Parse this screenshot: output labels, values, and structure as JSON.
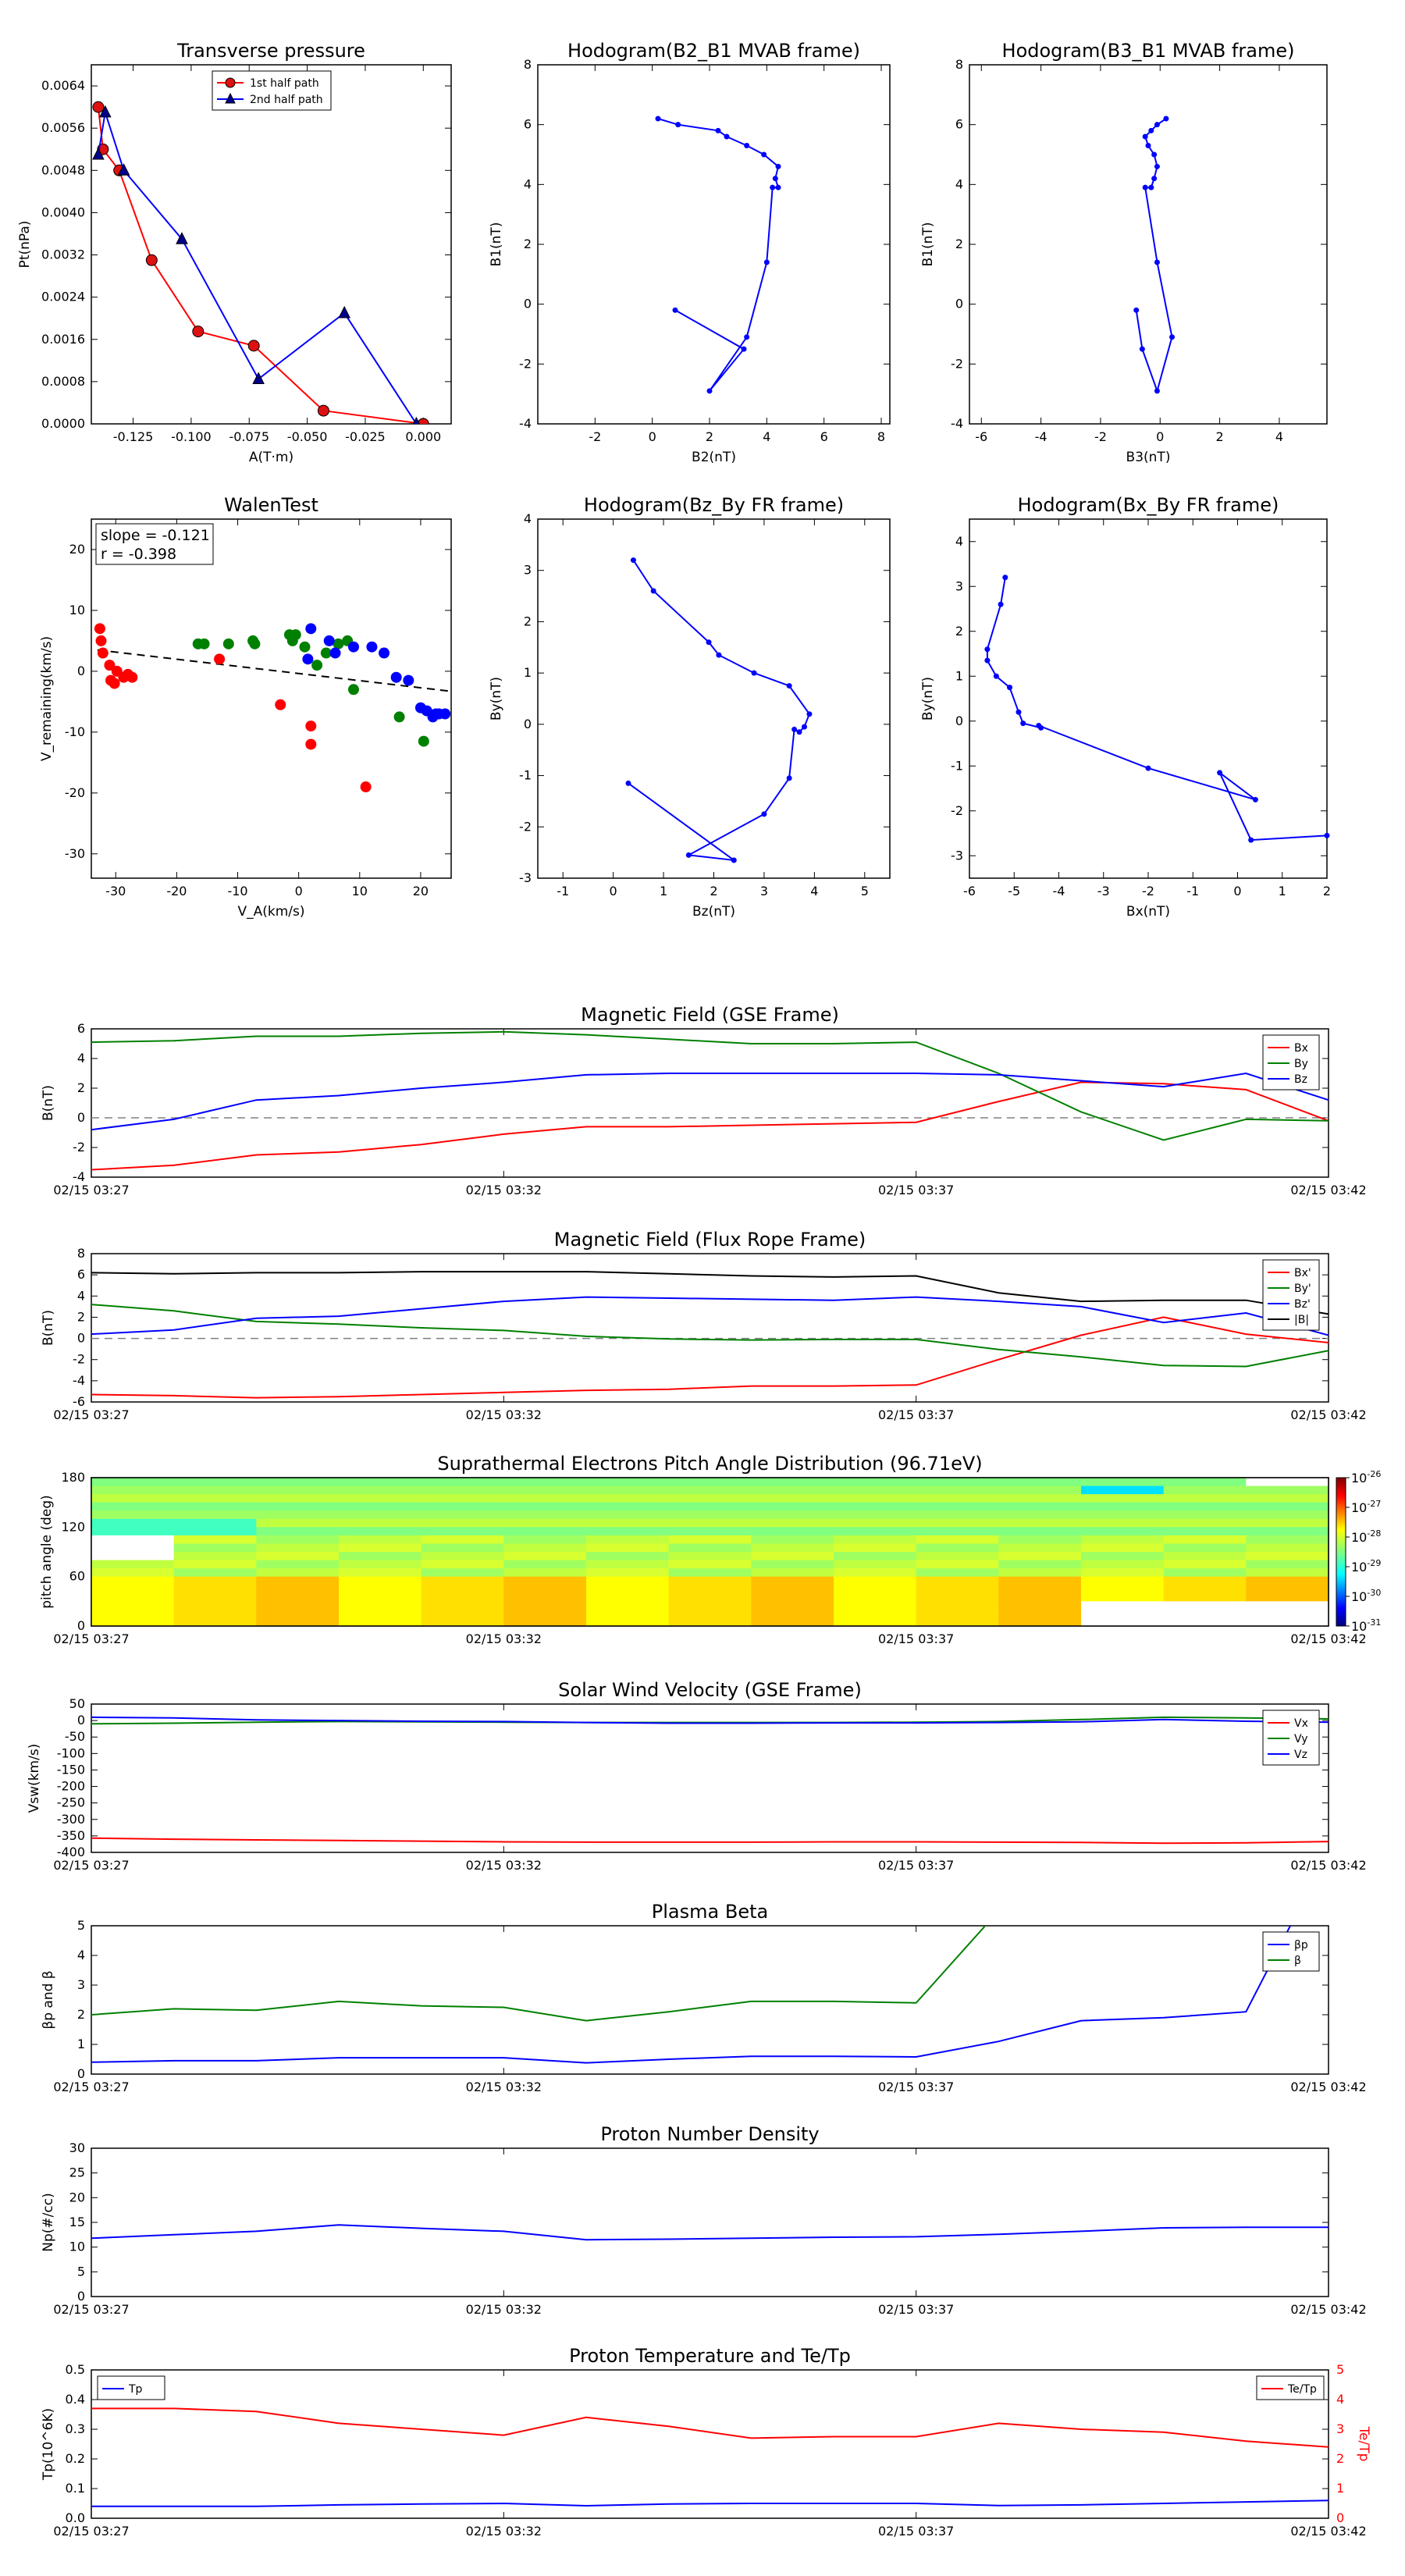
{
  "colors": {
    "red": "#ff0000",
    "green": "#008000",
    "blue": "#0000ff",
    "black": "#000000",
    "dash": "#808080"
  },
  "time_ticks": [
    "02/15 03:27",
    "02/15 03:32",
    "02/15 03:37",
    "02/15 03:42"
  ],
  "chart_data": [
    {
      "id": "pt",
      "type": "line",
      "title": "Transverse pressure",
      "xlabel": "A(T·m)",
      "ylabel": "Pt(nPa)",
      "xlim": [
        -0.143,
        0.012
      ],
      "ylim": [
        0,
        0.0068
      ],
      "xticks": [
        "-0.125",
        "-0.100",
        "-0.075",
        "-0.050",
        "-0.025",
        "0.000"
      ],
      "yticks": [
        "0.0000",
        "0.0008",
        "0.0016",
        "0.0024",
        "0.0032",
        "0.0040",
        "0.0048",
        "0.0056",
        "0.0064"
      ],
      "legend_position": "top-center",
      "series": [
        {
          "name": "1st half path",
          "marker": "circle",
          "x": [
            -0.14,
            -0.138,
            -0.131,
            -0.117,
            -0.097,
            -0.073,
            -0.043,
            0.0
          ],
          "y": [
            0.006,
            0.0052,
            0.0048,
            0.0031,
            0.00175,
            0.00148,
            0.00025,
            0.0
          ]
        },
        {
          "name": "2nd half path",
          "marker": "triangle",
          "x": [
            -0.14,
            -0.137,
            -0.129,
            -0.104,
            -0.071,
            -0.034,
            -0.003
          ],
          "y": [
            0.0051,
            0.0059,
            0.0048,
            0.0035,
            0.00085,
            0.0021,
            0.0
          ]
        }
      ]
    },
    {
      "id": "hb2",
      "type": "line",
      "title": "Hodogram(B2_B1 MVAB frame)",
      "xlabel": "B2(nT)",
      "ylabel": "B1(nT)",
      "xlim": [
        -4,
        8.3
      ],
      "ylim": [
        -4,
        8
      ],
      "xticks": [
        "-2",
        "0",
        "2",
        "4",
        "6",
        "8"
      ],
      "yticks": [
        "-4",
        "-2",
        "0",
        "2",
        "4",
        "6",
        "8"
      ],
      "x": [
        0.2,
        0.9,
        2.3,
        2.6,
        3.3,
        3.9,
        4.4,
        4.3,
        4.4,
        4.2,
        4.0,
        3.3,
        2.0,
        3.2,
        0.8
      ],
      "y": [
        6.2,
        6.0,
        5.8,
        5.6,
        5.3,
        5.0,
        4.6,
        4.2,
        3.9,
        3.9,
        1.4,
        -1.1,
        -2.9,
        -1.5,
        -0.2
      ]
    },
    {
      "id": "hb3",
      "type": "line",
      "title": "Hodogram(B3_B1 MVAB frame)",
      "xlabel": "B3(nT)",
      "ylabel": "B1(nT)",
      "xlim": [
        -6.4,
        5.6
      ],
      "ylim": [
        -4,
        8
      ],
      "xticks": [
        "-6",
        "-4",
        "-2",
        "0",
        "2",
        "4"
      ],
      "yticks": [
        "-4",
        "-2",
        "0",
        "2",
        "4",
        "6",
        "8"
      ],
      "x": [
        0.2,
        -0.1,
        -0.3,
        -0.5,
        -0.4,
        -0.2,
        -0.1,
        -0.2,
        -0.3,
        -0.5,
        -0.1,
        0.4,
        -0.1,
        -0.6,
        -0.8
      ],
      "y": [
        6.2,
        6.0,
        5.8,
        5.6,
        5.3,
        5.0,
        4.6,
        4.2,
        3.9,
        3.9,
        1.4,
        -1.1,
        -2.9,
        -1.5,
        -0.2
      ]
    },
    {
      "id": "walen",
      "type": "scatter",
      "title": "WalenTest",
      "xlabel": "V_A(km/s)",
      "ylabel": "V_remaining(km/s)",
      "xlim": [
        -34,
        25
      ],
      "ylim": [
        -34,
        25
      ],
      "xticks": [
        "-30",
        "-20",
        "-10",
        "0",
        "10",
        "20"
      ],
      "yticks": [
        "-30",
        "-20",
        "-10",
        "0",
        "10",
        "20"
      ],
      "slope_text": "slope = -0.121",
      "r_text": "r = -0.398",
      "fit": {
        "x": [
          -33,
          25
        ],
        "y": [
          3.5,
          -3.3
        ]
      },
      "groups": [
        {
          "color": "red",
          "x": [
            -32.6,
            -32.4,
            -32.1,
            -31,
            -30.8,
            -30.2,
            -29.8,
            -28.7,
            -28,
            -27.3,
            -13,
            -3,
            2,
            2,
            11
          ],
          "y": [
            7,
            5,
            3,
            1,
            -1.5,
            -2,
            0,
            -1,
            -0.5,
            -1,
            2,
            -5.5,
            -12,
            -9,
            -19
          ]
        },
        {
          "color": "green",
          "x": [
            -16.5,
            -15.5,
            -11.5,
            -7.5,
            -7.2,
            -1.5,
            -1,
            -0.5,
            1,
            3,
            4.5,
            6.5,
            8,
            9,
            16.5,
            20.5
          ],
          "y": [
            4.5,
            4.5,
            4.5,
            5,
            4.5,
            6,
            5,
            6,
            4,
            1,
            3,
            4.5,
            5,
            -3,
            -7.5,
            -11.5
          ]
        },
        {
          "color": "blue",
          "x": [
            1.5,
            2,
            5,
            6,
            9,
            12,
            14,
            16,
            18,
            20,
            21,
            22,
            22.5,
            23,
            24
          ],
          "y": [
            2,
            7,
            5,
            3,
            4,
            4,
            3,
            -1,
            -1.5,
            -6,
            -6.5,
            -7.5,
            -7,
            -7,
            -7
          ]
        }
      ]
    },
    {
      "id": "hbzby",
      "type": "line",
      "title": "Hodogram(Bz_By FR frame)",
      "xlabel": "Bz(nT)",
      "ylabel": "By(nT)",
      "xlim": [
        -1.5,
        5.5
      ],
      "ylim": [
        -3,
        4
      ],
      "xticks": [
        "-1",
        "0",
        "1",
        "2",
        "3",
        "4",
        "5"
      ],
      "yticks": [
        "-3",
        "-2",
        "-1",
        "0",
        "1",
        "2",
        "3",
        "4"
      ],
      "x": [
        0.4,
        0.8,
        1.9,
        2.1,
        2.8,
        3.5,
        3.9,
        3.8,
        3.7,
        3.6,
        3.5,
        3.0,
        1.5,
        2.4,
        0.3
      ],
      "y": [
        3.2,
        2.6,
        1.6,
        1.35,
        1.0,
        0.75,
        0.2,
        -0.05,
        -0.15,
        -0.1,
        -1.05,
        -1.75,
        -2.55,
        -2.65,
        -1.15
      ]
    },
    {
      "id": "hbxby",
      "type": "line",
      "title": "Hodogram(Bx_By FR frame)",
      "xlabel": "Bx(nT)",
      "ylabel": "By(nT)",
      "xlim": [
        -6,
        2
      ],
      "ylim": [
        -3.5,
        4.5
      ],
      "xticks": [
        "-6",
        "-5",
        "-4",
        "-3",
        "-2",
        "-1",
        "0",
        "1",
        "2"
      ],
      "yticks": [
        "-3",
        "-2",
        "-1",
        "0",
        "1",
        "2",
        "3",
        "4"
      ],
      "x": [
        -5.2,
        -5.3,
        -5.6,
        -5.6,
        -5.4,
        -5.1,
        -4.9,
        -4.8,
        -4.4,
        -4.45,
        -2.0,
        0.4,
        -0.4,
        0.3,
        2.0
      ],
      "y": [
        3.2,
        2.6,
        1.6,
        1.35,
        1.0,
        0.75,
        0.2,
        -0.05,
        -0.15,
        -0.1,
        -1.05,
        -1.75,
        -1.15,
        -2.65,
        -2.55
      ]
    },
    {
      "id": "bgse",
      "type": "line",
      "title": "Magnetic Field (GSE Frame)",
      "ylabel": "B(nT)",
      "ylim": [
        -4,
        6
      ],
      "yticks": [
        "-4",
        "-2",
        "0",
        "2",
        "4",
        "6"
      ],
      "zero_line": true,
      "x_times": [
        0,
        1,
        2,
        3,
        4,
        5,
        6,
        7,
        8,
        9,
        10,
        11,
        12,
        13,
        14,
        15
      ],
      "series": [
        {
          "name": "Bx",
          "color": "red",
          "values": [
            -3.5,
            -3.2,
            -2.5,
            -2.3,
            -1.8,
            -1.1,
            -0.6,
            -0.6,
            -0.5,
            -0.4,
            -0.3,
            1.1,
            2.4,
            2.3,
            1.9,
            -0.2
          ]
        },
        {
          "name": "By",
          "color": "green",
          "values": [
            5.1,
            5.2,
            5.5,
            5.5,
            5.7,
            5.8,
            5.6,
            5.3,
            5.0,
            5.0,
            5.1,
            3.0,
            0.4,
            -1.5,
            -0.1,
            -0.2
          ]
        },
        {
          "name": "Bz",
          "color": "blue",
          "values": [
            -0.8,
            -0.1,
            1.2,
            1.5,
            2.0,
            2.4,
            2.9,
            3.0,
            3.0,
            3.0,
            3.0,
            2.9,
            2.5,
            2.1,
            3.0,
            1.2
          ]
        }
      ]
    },
    {
      "id": "bfr",
      "type": "line",
      "title": "Magnetic Field (Flux Rope Frame)",
      "ylabel": "B(nT)",
      "ylim": [
        -6,
        8
      ],
      "yticks": [
        "-6",
        "-4",
        "-2",
        "0",
        "2",
        "4",
        "6",
        "8"
      ],
      "zero_line": true,
      "x_times": [
        0,
        1,
        2,
        3,
        4,
        5,
        6,
        7,
        8,
        9,
        10,
        11,
        12,
        13,
        14,
        15
      ],
      "series": [
        {
          "name": "Bx'",
          "color": "red",
          "values": [
            -5.3,
            -5.4,
            -5.6,
            -5.5,
            -5.3,
            -5.1,
            -4.9,
            -4.8,
            -4.5,
            -4.5,
            -4.4,
            -2.0,
            0.3,
            2.0,
            0.4,
            -0.4
          ]
        },
        {
          "name": "By'",
          "color": "green",
          "values": [
            3.2,
            2.6,
            1.6,
            1.35,
            1.0,
            0.75,
            0.2,
            -0.05,
            -0.15,
            -0.1,
            -0.1,
            -1.05,
            -1.75,
            -2.55,
            -2.65,
            -1.15
          ]
        },
        {
          "name": "Bz'",
          "color": "blue",
          "values": [
            0.4,
            0.8,
            1.9,
            2.1,
            2.8,
            3.5,
            3.9,
            3.8,
            3.7,
            3.6,
            3.9,
            3.5,
            3.0,
            1.5,
            2.4,
            0.3
          ]
        },
        {
          "name": "|B|",
          "color": "black",
          "values": [
            6.2,
            6.1,
            6.2,
            6.2,
            6.3,
            6.3,
            6.3,
            6.1,
            5.9,
            5.8,
            5.9,
            4.3,
            3.5,
            3.6,
            3.6,
            2.3
          ]
        }
      ]
    },
    {
      "id": "pad",
      "type": "heatmap",
      "title": "Suprathermal Electrons Pitch Angle Distribution (96.71eV)",
      "ylabel": "pitch angle (deg)",
      "ylim": [
        0,
        180
      ],
      "yticks": [
        "0",
        "60",
        "120",
        "180"
      ],
      "colorbar_ticks": [
        "10^-26",
        "10^-27",
        "10^-28",
        "10^-29",
        "10^-30",
        "10^-31"
      ],
      "colorbar_range_log10": [
        -31,
        -26
      ]
    },
    {
      "id": "vsw",
      "type": "line",
      "title": "Solar Wind Velocity (GSE Frame)",
      "ylabel": "Vsw(km/s)",
      "ylim": [
        -400,
        50
      ],
      "yticks": [
        "-400",
        "-350",
        "-300",
        "-250",
        "-200",
        "-150",
        "-100",
        "-50",
        "0",
        "50"
      ],
      "x_times": [
        0,
        1,
        2,
        3,
        4,
        5,
        6,
        7,
        8,
        9,
        10,
        11,
        12,
        13,
        14,
        15
      ],
      "series": [
        {
          "name": "Vx",
          "color": "red",
          "values": [
            -357,
            -360,
            -362,
            -364,
            -366,
            -368,
            -369,
            -369,
            -369,
            -368,
            -368,
            -369,
            -370,
            -372,
            -371,
            -367
          ]
        },
        {
          "name": "Vy",
          "color": "green",
          "values": [
            -10,
            -8,
            -5,
            -3,
            -4,
            -5,
            -6,
            -6,
            -6,
            -6,
            -5,
            -3,
            3,
            10,
            8,
            5
          ]
        },
        {
          "name": "Vz",
          "color": "blue",
          "values": [
            10,
            8,
            2,
            0,
            -2,
            -3,
            -6,
            -8,
            -8,
            -7,
            -7,
            -6,
            -4,
            3,
            -2,
            -5
          ]
        }
      ]
    },
    {
      "id": "beta",
      "type": "line",
      "title": "Plasma Beta",
      "ylabel": "βp and β",
      "ylim": [
        0,
        5
      ],
      "yticks": [
        "0",
        "1",
        "2",
        "3",
        "4",
        "5"
      ],
      "x_times": [
        0,
        1,
        2,
        3,
        4,
        5,
        6,
        7,
        8,
        9,
        10,
        11,
        12,
        13,
        14,
        15
      ],
      "series": [
        {
          "name": "βp",
          "color": "blue",
          "values": [
            0.4,
            0.45,
            0.45,
            0.55,
            0.55,
            0.55,
            0.38,
            0.5,
            0.6,
            0.6,
            0.58,
            1.1,
            1.8,
            1.9,
            2.1,
            7.5
          ]
        },
        {
          "name": "β",
          "color": "green",
          "values": [
            2.0,
            2.2,
            2.15,
            2.45,
            2.3,
            2.25,
            1.8,
            2.1,
            2.45,
            2.45,
            2.4,
            5.5,
            9,
            9,
            9,
            9
          ]
        }
      ]
    },
    {
      "id": "np",
      "type": "line",
      "title": "Proton Number Density",
      "ylabel": "Np(#/cc)",
      "ylim": [
        0,
        30
      ],
      "yticks": [
        "0",
        "5",
        "10",
        "15",
        "20",
        "25",
        "30"
      ],
      "x_times": [
        0,
        1,
        2,
        3,
        4,
        5,
        6,
        7,
        8,
        9,
        10,
        11,
        12,
        13,
        14,
        15
      ],
      "series": [
        {
          "name": "Np",
          "color": "blue",
          "values": [
            11.8,
            12.5,
            13.2,
            14.5,
            13.8,
            13.2,
            11.5,
            11.6,
            11.8,
            12.0,
            12.1,
            12.6,
            13.2,
            13.9,
            14.0,
            14.0
          ]
        }
      ]
    },
    {
      "id": "tp",
      "type": "line",
      "title": "Proton Temperature and Te/Tp",
      "ylabel": "Tp(10^6K)",
      "ylabel_right": "Te/Tp",
      "ylim": [
        0,
        0.5
      ],
      "yticks": [
        "0.0",
        "0.1",
        "0.2",
        "0.3",
        "0.4",
        "0.5"
      ],
      "ylim_right": [
        0,
        5
      ],
      "yticks_right": [
        "0",
        "1",
        "2",
        "3",
        "4",
        "5"
      ],
      "x_times": [
        0,
        1,
        2,
        3,
        4,
        5,
        6,
        7,
        8,
        9,
        10,
        11,
        12,
        13,
        14,
        15
      ],
      "series": [
        {
          "name": "Tp",
          "color": "blue",
          "axis": "left",
          "values": [
            0.04,
            0.04,
            0.04,
            0.045,
            0.048,
            0.05,
            0.042,
            0.048,
            0.05,
            0.05,
            0.05,
            0.043,
            0.045,
            0.05,
            0.055,
            0.06
          ]
        },
        {
          "name": "Te/Tp",
          "color": "red",
          "axis": "right",
          "values": [
            3.7,
            3.7,
            3.6,
            3.2,
            3.0,
            2.8,
            3.4,
            3.1,
            2.7,
            2.75,
            2.75,
            3.2,
            3.0,
            2.9,
            2.6,
            2.4
          ]
        }
      ]
    }
  ]
}
